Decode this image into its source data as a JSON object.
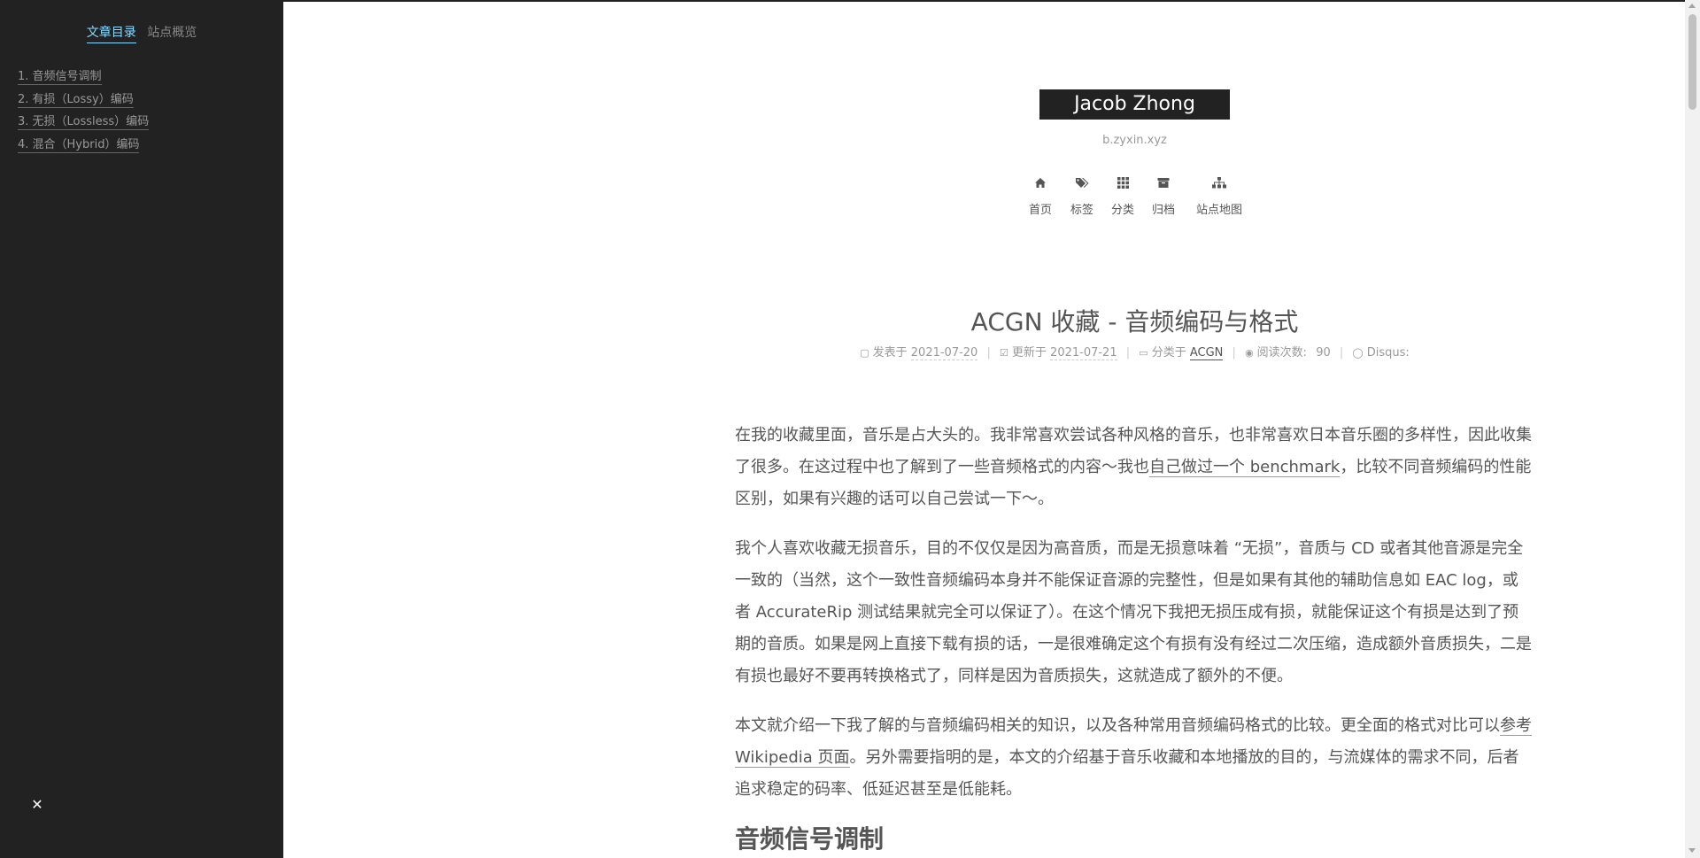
{
  "sidebar": {
    "tabs": [
      {
        "label": "文章目录",
        "active": true
      },
      {
        "label": "站点概览",
        "active": false
      }
    ],
    "toc": [
      "1. 音频信号调制",
      "2. 有损（Lossy）编码",
      "3. 无损（Lossless）编码",
      "4. 混合（Hybrid）编码"
    ],
    "close_icon": "close-icon"
  },
  "header": {
    "site_title": "Jacob Zhong",
    "subtitle": "b.zyxin.xyz",
    "nav": [
      {
        "label": "首页",
        "icon": "home-icon"
      },
      {
        "label": "标签",
        "icon": "tags-icon"
      },
      {
        "label": "分类",
        "icon": "th-icon"
      },
      {
        "label": "归档",
        "icon": "archive-icon"
      },
      {
        "label": "站点地图",
        "icon": "sitemap-icon"
      }
    ]
  },
  "post": {
    "title": "ACGN 收藏 - 音频编码与格式",
    "meta": {
      "posted_label": "发表于",
      "posted_date": "2021-07-20",
      "updated_label": "更新于",
      "updated_date": "2021-07-21",
      "category_label": "分类于",
      "category": "ACGN",
      "views_label": "阅读次数:",
      "views": "90",
      "comments_label": "Disqus:"
    },
    "p1": {
      "a": "在我的收藏里面，音乐是占大头的。我非常喜欢尝试各种风格的音乐，也非常喜欢日本音乐圈的多样性，因此收集了很多。在这过程中也了解到了一些音频格式的内容～我也",
      "link": "自己做过一个 benchmark",
      "b": "，比较不同音频编码的性能区别，如果有兴趣的话可以自己尝试一下～。"
    },
    "p2": "我个人喜欢收藏无损音乐，目的不仅仅是因为高音质，而是无损意味着 “无损”，音质与 CD 或者其他音源是完全一致的（当然，这个一致性音频编码本身并不能保证音源的完整性，但是如果有其他的辅助信息如 EAC log，或者 AccurateRip 测试结果就完全可以保证了）。在这个情况下我把无损压成有损，就能保证这个有损是达到了预期的音质。如果是网上直接下载有损的话，一是很难确定这个有损有没有经过二次压缩，造成额外音质损失，二是有损也最好不要再转换格式了，同样是因为音质损失，这就造成了额外的不便。",
    "p3": {
      "a": "本文就介绍一下我了解的与音频编码相关的知识，以及各种常用音频编码格式的比较。更全面的格式对比可以",
      "link": "参考 Wikipedia 页面",
      "b": "。另外需要指明的是，本文的介绍基于音乐收藏和本地播放的目的，与流媒体的需求不同，后者追求稳定的码率、低延迟甚至是低能耗。"
    },
    "section_heading": "音频信号调制"
  }
}
